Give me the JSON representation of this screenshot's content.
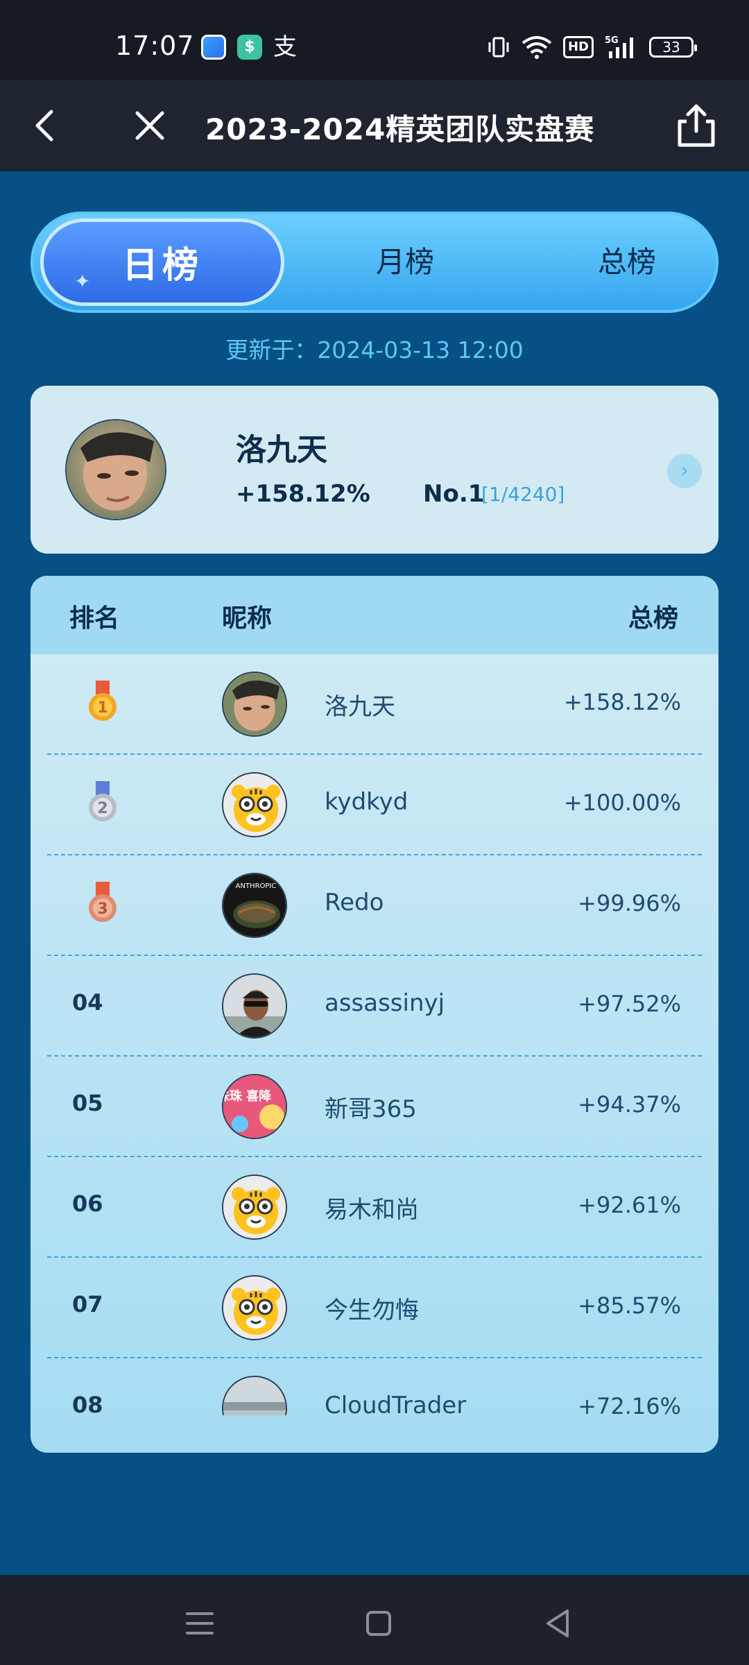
{
  "status_bar": {
    "time": "17:07",
    "icons": [
      "app-blue-icon",
      "app-green-icon",
      "alipay-icon"
    ],
    "hd": "HD",
    "network": "5G",
    "battery": "33"
  },
  "header": {
    "title": "2023-2024精英团队实盘赛"
  },
  "tabs": [
    {
      "label": "日榜",
      "active": true
    },
    {
      "label": "月榜",
      "active": false
    },
    {
      "label": "总榜",
      "active": false
    }
  ],
  "update": {
    "text": "更新于：2024-03-13 12:00"
  },
  "me": {
    "name": "洛九天",
    "pct": "+158.12%",
    "rank": "No.1",
    "rank_total": "[1/4240]"
  },
  "table": {
    "headers": {
      "rank": "排名",
      "nickname": "昵称",
      "total": "总榜"
    },
    "rows": [
      {
        "rank": "1",
        "medal": "gold",
        "avatar": "face",
        "name": "洛九天",
        "pct": "+158.12%"
      },
      {
        "rank": "2",
        "medal": "silver",
        "avatar": "tiger",
        "name": "kydkyd",
        "pct": "+100.00%"
      },
      {
        "rank": "3",
        "medal": "bronze",
        "avatar": "anthropic",
        "name": "Redo",
        "pct": "+99.96%"
      },
      {
        "rank": "04",
        "medal": "",
        "avatar": "person",
        "name": "assassinyj",
        "pct": "+97.52%"
      },
      {
        "rank": "05",
        "medal": "",
        "avatar": "pink",
        "name": "新哥365",
        "pct": "+94.37%"
      },
      {
        "rank": "06",
        "medal": "",
        "avatar": "tiger",
        "name": "易木和尚",
        "pct": "+92.61%"
      },
      {
        "rank": "07",
        "medal": "",
        "avatar": "tiger",
        "name": "今生勿悔",
        "pct": "+85.57%"
      },
      {
        "rank": "08",
        "medal": "",
        "avatar": "sky",
        "name": "CloudTrader",
        "pct": "+72.16%"
      }
    ],
    "avatar_labels": {
      "anthropic": "ANTHROPIC",
      "pink": "珠珠 喜降"
    }
  },
  "nav": [
    "menu-icon",
    "home-icon",
    "back-icon"
  ],
  "colors": {
    "background": "#075086",
    "header": "#1f2530",
    "tab_active": "#2e6be6",
    "accent": "#3aa3d9"
  }
}
